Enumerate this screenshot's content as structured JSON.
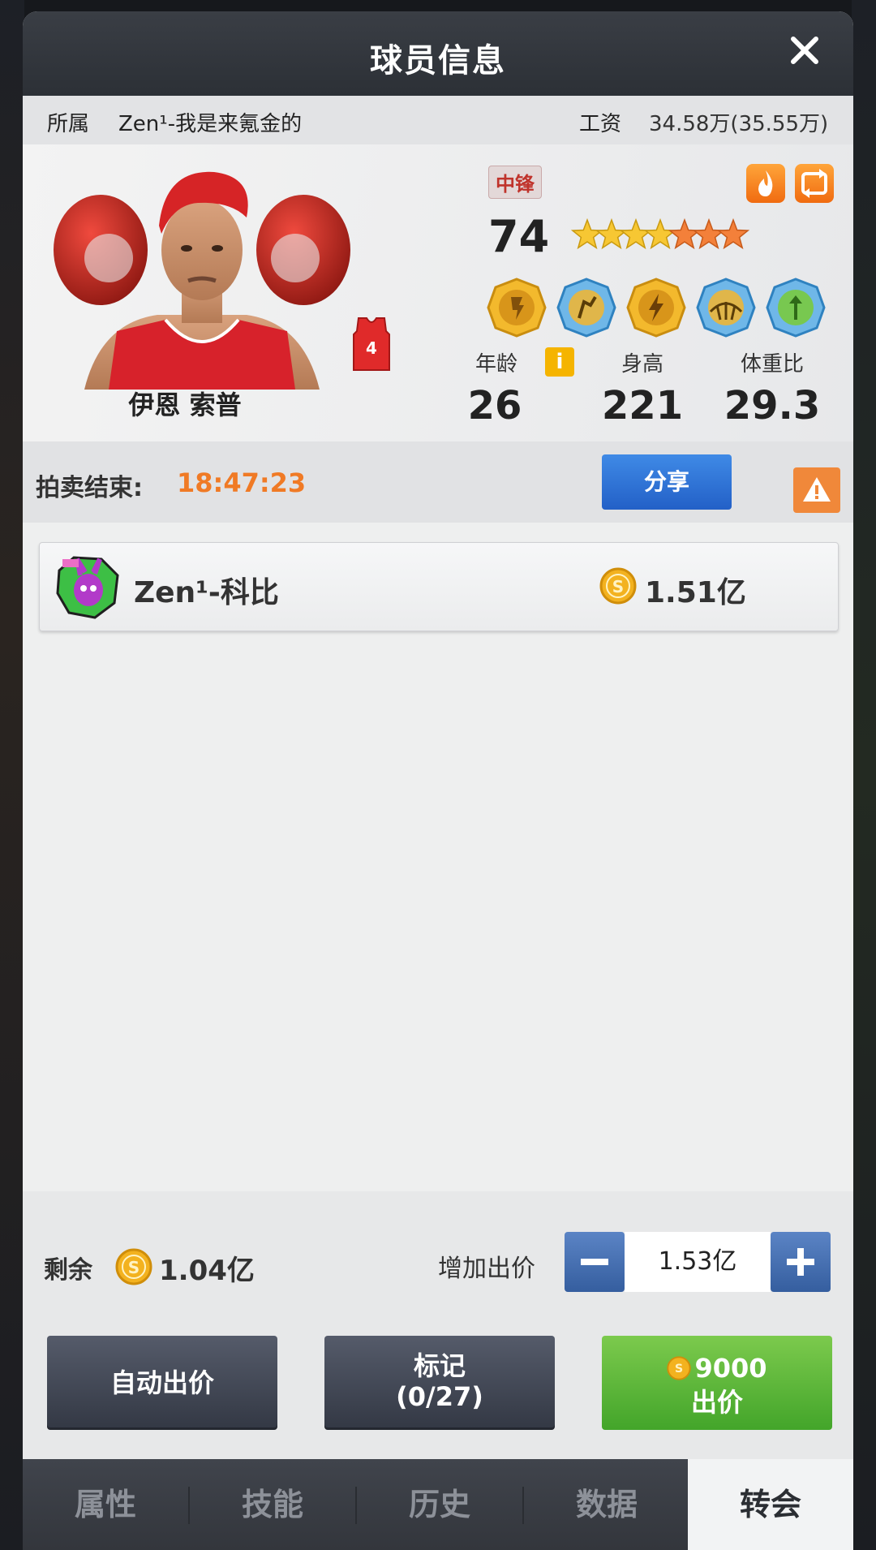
{
  "header": {
    "title": "球员信息"
  },
  "owner": {
    "label": "所属",
    "value": "Zen¹-我是来氪金的"
  },
  "salary": {
    "label": "工资",
    "value": "34.58万(35.55万)"
  },
  "player": {
    "name": "伊恩 索普",
    "jersey_number": "4",
    "position": "中锋",
    "rating": "74",
    "stars_total": 7,
    "stars_gold": 4,
    "stars_orange": 3
  },
  "stats": [
    {
      "label": "年龄",
      "value": "26"
    },
    {
      "label": "身高",
      "value": "221"
    },
    {
      "label": "体重比",
      "value": "29.3"
    }
  ],
  "auction": {
    "end_label": "拍卖结束:",
    "end_time": "18:47:23",
    "share_label": "分享"
  },
  "bids": [
    {
      "bidder": "Zen¹-科比",
      "amount": "1.51亿"
    }
  ],
  "remaining": {
    "label": "剩余",
    "value": "1.04亿"
  },
  "increase": {
    "label": "增加出价",
    "value": "1.53亿"
  },
  "actions": {
    "auto_bid": "自动出价",
    "mark_line1": "标记",
    "mark_line2": "(0/27)",
    "bid_price": "9000",
    "bid_label": "出价"
  },
  "tabs": [
    {
      "label": "属性"
    },
    {
      "label": "技能"
    },
    {
      "label": "历史"
    },
    {
      "label": "数据"
    },
    {
      "label": "转会"
    }
  ],
  "colors": {
    "accent_orange": "#f07a25",
    "share_blue": "#2f74d6",
    "bid_green": "#5bb838",
    "title_bar": "#32363c"
  }
}
